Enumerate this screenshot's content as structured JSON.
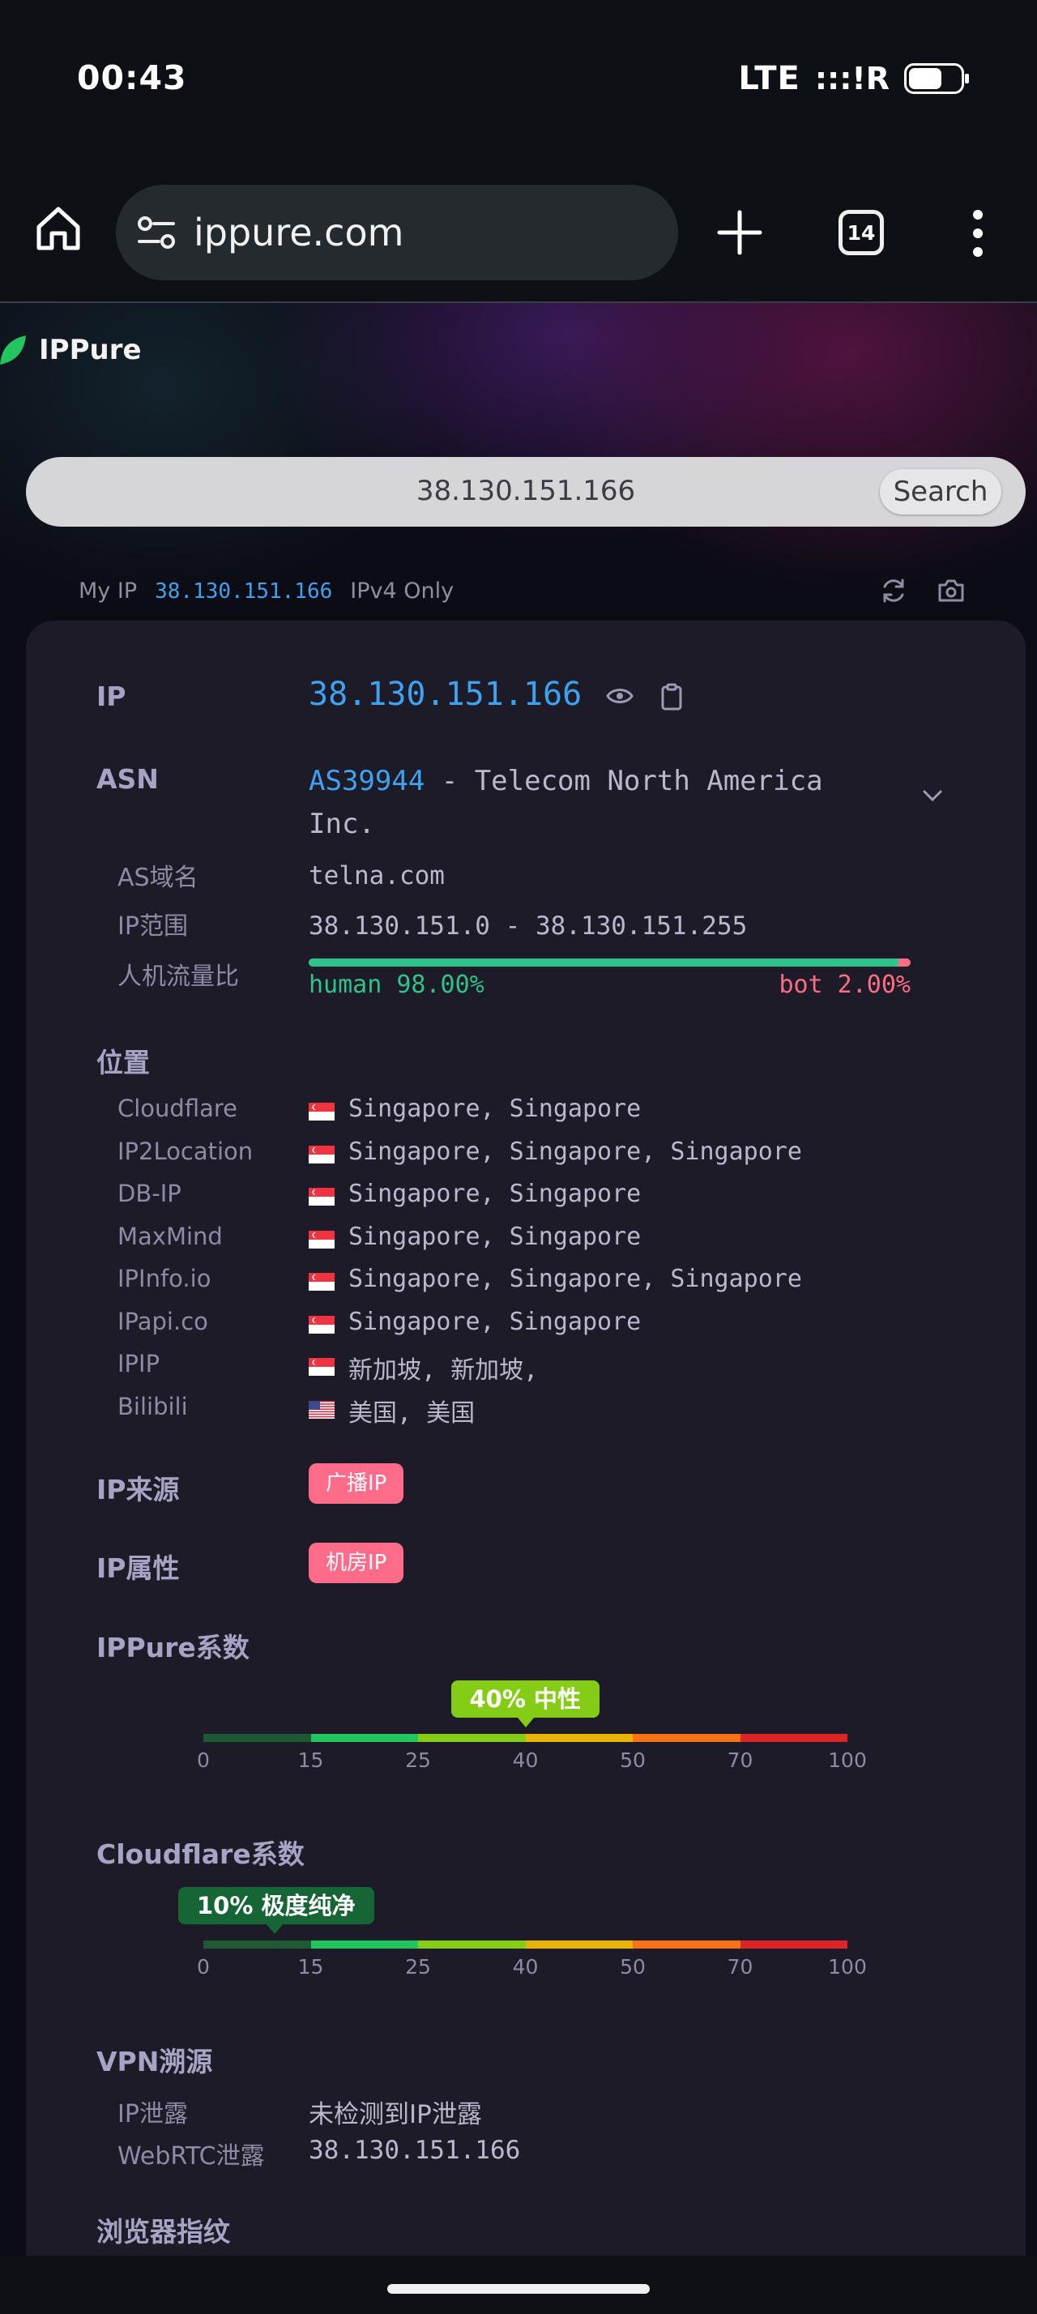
{
  "status_bar": {
    "time": "00:43",
    "network": "LTE",
    "signal_text": ":::!R"
  },
  "browser": {
    "url": "ippure.com",
    "tab_count": "14"
  },
  "site": {
    "logo_text": "IPPure",
    "search_value": "38.130.151.166",
    "search_button": "Search",
    "my_ip_label": "My IP",
    "my_ip_value": "38.130.151.166",
    "ip_mode": "IPv4 Only"
  },
  "info": {
    "ip_label": "IP",
    "ip_value": "38.130.151.166",
    "asn_label": "ASN",
    "asn_number": "AS39944",
    "asn_name": " - Telecom North America Inc.",
    "as_domain_label": "AS域名",
    "as_domain_value": "telna.com",
    "ip_range_label": "IP范围",
    "ip_range_value": "38.130.151.0 - 38.130.151.255",
    "traffic_label": "人机流量比",
    "human_label": "human 98.00%",
    "bot_label": "bot 2.00%",
    "human_fraction": 0.98
  },
  "location": {
    "label": "位置",
    "rows": [
      {
        "source": "Cloudflare",
        "flag": "sg",
        "text": "Singapore, Singapore"
      },
      {
        "source": "IP2Location",
        "flag": "sg",
        "text": "Singapore, Singapore, Singapore"
      },
      {
        "source": "DB-IP",
        "flag": "sg",
        "text": "Singapore, Singapore"
      },
      {
        "source": "MaxMind",
        "flag": "sg",
        "text": "Singapore, Singapore"
      },
      {
        "source": "IPInfo.io",
        "flag": "sg",
        "text": "Singapore, Singapore, Singapore"
      },
      {
        "source": "IPapi.co",
        "flag": "sg",
        "text": "Singapore, Singapore"
      },
      {
        "source": "IPIP",
        "flag": "sg",
        "text": "新加坡, 新加坡,"
      },
      {
        "source": "Bilibili",
        "flag": "us",
        "text": "美国, 美国"
      }
    ]
  },
  "ip_source": {
    "label": "IP来源",
    "tag": "广播IP"
  },
  "ip_attr": {
    "label": "IP属性",
    "tag": "机房IP"
  },
  "ippure_score": {
    "label": "IPPure系数",
    "value": 40,
    "badge": "40% 中性",
    "badge_color": "#84cc16"
  },
  "cloudflare_score": {
    "label": "Cloudflare系数",
    "value": 10,
    "badge": "10% 极度纯净",
    "badge_color": "#166534"
  },
  "gauge": {
    "ticks": [
      "0",
      "15",
      "25",
      "40",
      "50",
      "70",
      "100"
    ],
    "segments": [
      "#1d5a34",
      "#22c55e",
      "#84cc16",
      "#eab308",
      "#f97316",
      "#dc2626"
    ]
  },
  "vpn": {
    "label": "VPN溯源",
    "ip_leak_label": "IP泄露",
    "ip_leak_value": "未检测到IP泄露",
    "webrtc_label": "WebRTC泄露",
    "webrtc_value": "38.130.151.166"
  },
  "fingerprint": {
    "label": "浏览器指纹"
  }
}
